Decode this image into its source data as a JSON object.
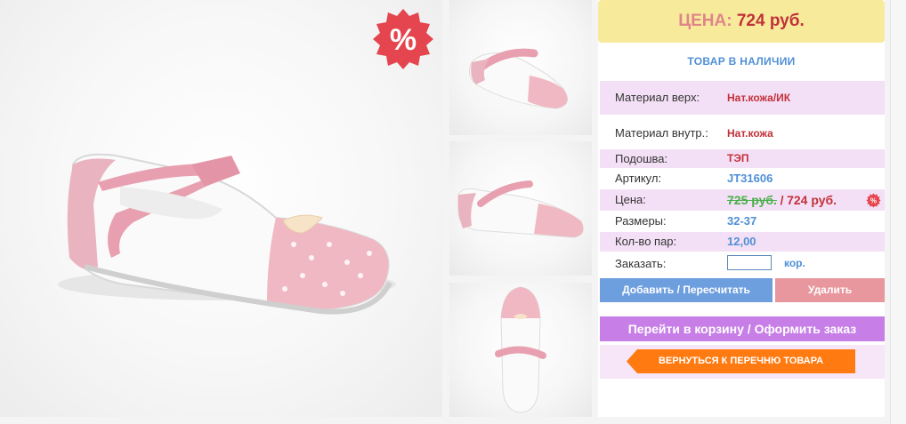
{
  "sale_badge": {
    "symbol": "%",
    "color": "#e4454e"
  },
  "gallery": {
    "main_alt": "pink and white girls shoe side view",
    "thumbnails": [
      "shoe angled view",
      "shoe side view",
      "shoe top view"
    ]
  },
  "price_box": {
    "label": "ЦЕНА:",
    "value": "724 руб."
  },
  "stock_status": "ТОВАР В НАЛИЧИИ",
  "specs": {
    "material_top": {
      "label": "Материал верх:",
      "value": "Нат.кожа/ИК"
    },
    "material_inner": {
      "label": "Материал внутр.:",
      "value": "Нат.кожа"
    },
    "sole": {
      "label": "Подошва:",
      "value": "ТЭП"
    },
    "article": {
      "label": "Артикул:",
      "value": "JT31606"
    },
    "price": {
      "label": "Цена:",
      "old": "725 руб.",
      "separator": "/",
      "new": "724 руб."
    },
    "sizes": {
      "label": "Размеры:",
      "value": "32-37"
    },
    "pairs": {
      "label": "Кол-во пар:",
      "value": "12,00"
    },
    "order": {
      "label": "Заказать:",
      "input_value": "",
      "unit": "кор."
    }
  },
  "buttons": {
    "add": "Добавить / Пересчитать",
    "delete": "Удалить",
    "cart": "Перейти в корзину / Оформить заказ",
    "back": "ВЕРНУТЬСЯ К ПЕРЕЧНЮ ТОВАРА"
  },
  "colors": {
    "accent_blue": "#4f8fd6",
    "price_red": "#c2313a",
    "old_price_green": "#48b04a",
    "row_pink": "#f4e0f6",
    "price_yellow": "#f7eb9b",
    "cart_purple": "#c77ee7",
    "back_orange": "#ff7a10"
  }
}
